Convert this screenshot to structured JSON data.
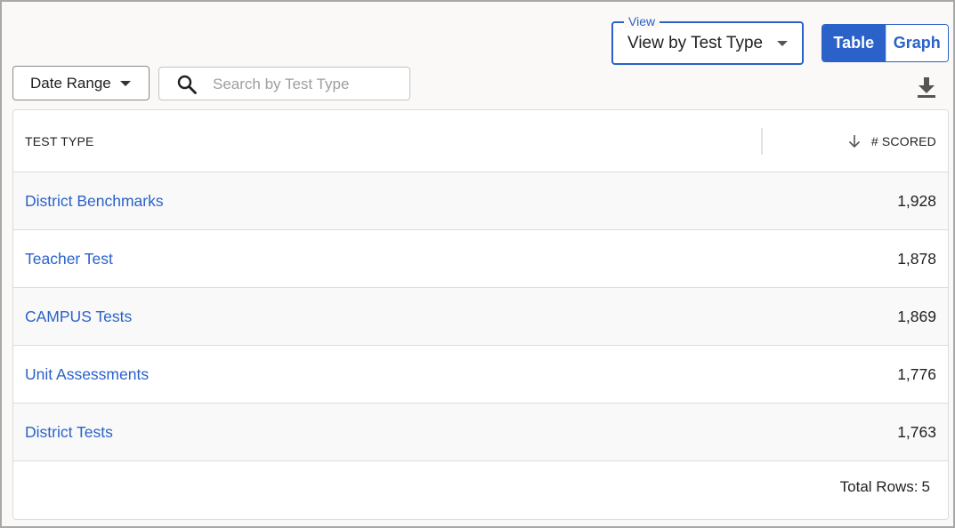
{
  "view": {
    "legend": "View",
    "selected": "View by Test Type"
  },
  "toggle": {
    "table_label": "Table",
    "graph_label": "Graph",
    "active": "Table"
  },
  "date_range": {
    "label": "Date Range"
  },
  "search": {
    "placeholder": "Search by Test Type",
    "value": ""
  },
  "icons": {
    "search": "search-icon",
    "download": "download-icon",
    "sort": "arrow-down-icon",
    "dropdown": "chevron-down-icon"
  },
  "colors": {
    "accent": "#2a62c9",
    "border": "#dcdcdc",
    "row_alt": "#f9f9f9"
  },
  "table": {
    "columns": {
      "test_type": "TEST TYPE",
      "scored": "# SCORED"
    },
    "sort": {
      "column": "# SCORED",
      "direction": "descending"
    },
    "rows": [
      {
        "test_type": "District Benchmarks",
        "scored": "1,928"
      },
      {
        "test_type": "Teacher Test",
        "scored": "1,878"
      },
      {
        "test_type": "CAMPUS Tests",
        "scored": "1,869"
      },
      {
        "test_type": "Unit Assessments",
        "scored": "1,776"
      },
      {
        "test_type": "District Tests",
        "scored": "1,763"
      }
    ],
    "footer": {
      "total_label": "Total Rows:",
      "total_value": "5"
    }
  }
}
